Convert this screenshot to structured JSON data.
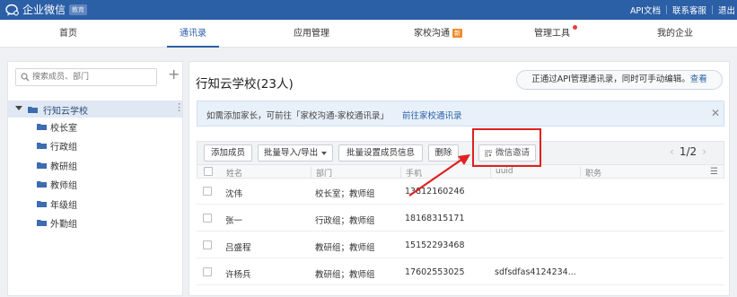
{
  "topbar": {
    "logo_text": "企业微信",
    "logo_badge": "教育",
    "links": [
      {
        "label": "API文档"
      },
      {
        "label": "联系客服"
      },
      {
        "label": "退出"
      }
    ]
  },
  "nav": {
    "items": [
      {
        "label": "首页"
      },
      {
        "label": "通讯录"
      },
      {
        "label": "应用管理"
      },
      {
        "label": "家校沟通",
        "badge": "新"
      },
      {
        "label": "管理工具"
      },
      {
        "label": "我的企业"
      }
    ],
    "active": "通讯录"
  },
  "sidebar": {
    "search_placeholder": "搜索成员、部门",
    "root": {
      "label": "行知云学校"
    },
    "departments": [
      {
        "label": "校长室"
      },
      {
        "label": "行政组"
      },
      {
        "label": "教研组"
      },
      {
        "label": "教师组"
      },
      {
        "label": "年级组"
      },
      {
        "label": "外勤组"
      }
    ]
  },
  "main": {
    "title": "行知云学校(23人)",
    "api_note": "正通过API管理通讯录，同时可手动编辑。",
    "api_link": "查看",
    "notice_text": "如需添加家长，可前往「家校沟通-家校通讯录」",
    "notice_link": "前往家校通讯录",
    "toolbar": {
      "add_member": "添加成员",
      "import_export": "批量导入/导出",
      "batch_set": "批量设置成员信息",
      "delete": "删除",
      "wechat_invite": "微信邀请",
      "page": "1/2"
    },
    "columns": [
      "姓名",
      "部门",
      "手机",
      "uuid",
      "职务"
    ],
    "rows": [
      {
        "name": "沈伟",
        "dept": "校长室；教师组",
        "phone": "13812160246",
        "uuid": "",
        "title": ""
      },
      {
        "name": "张一",
        "dept": "行政组；教师组",
        "phone": "18168315171",
        "uuid": "",
        "title": ""
      },
      {
        "name": "吕盛程",
        "dept": "教研组；教师组",
        "phone": "15152293468",
        "uuid": "",
        "title": ""
      },
      {
        "name": "许杨兵",
        "dept": "教研组；教师组",
        "phone": "17602553025",
        "uuid": "sdfsdfas4124234...",
        "title": ""
      }
    ]
  },
  "colors": {
    "brand": "#2b5fa6",
    "highlight": "#e02020",
    "badge": "#f08a2c"
  }
}
